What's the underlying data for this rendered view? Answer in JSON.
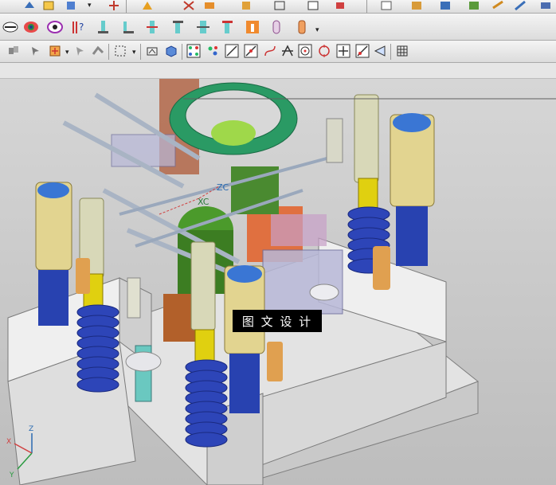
{
  "toolbar_row1": {
    "icons": [
      "snap-icon",
      "book-icon",
      "cube-icon",
      "move-icon",
      "hook-icon",
      "cut-icon",
      "layers-icon",
      "save-icon",
      "face-icon",
      "shape-icon",
      "mirror-icon",
      "window-icon",
      "arrow-icon",
      "fill-icon",
      "book2-icon",
      "block-icon",
      "paint-icon",
      "layer-icon",
      "send-icon"
    ]
  },
  "toolbar_row2": {
    "icons": [
      "eye-slash-icon",
      "eye-toggle-icon",
      "eye-ring-icon",
      "help-question-icon",
      "align-left-icon",
      "align-bottom-icon",
      "align-center-icon",
      "align-top-icon",
      "align-split-icon",
      "align-middle-icon",
      "insert-orange-icon",
      "capsule-icon",
      "cylinder-orange-icon"
    ]
  },
  "toolbar_row3": {
    "icons": [
      "undo-icon",
      "select-icon",
      "pick-orange-icon",
      "pointer-icon",
      "drag-icon",
      "box-select-icon",
      "shade-icon",
      "cube-blue-icon",
      "snap-grid-icon",
      "snap-point-icon",
      "line-icon",
      "midpoint-icon",
      "curve-icon",
      "intersect-icon",
      "center-icon",
      "circle-point-icon",
      "plus-icon",
      "tangent-icon",
      "fan-icon",
      "grid-small-icon"
    ]
  },
  "viewport": {
    "axis_labels": [
      "XC",
      "ZC"
    ],
    "triad_labels": [
      "Z",
      "X",
      "Y"
    ]
  },
  "watermark": {
    "text": "图 文 设 计"
  }
}
